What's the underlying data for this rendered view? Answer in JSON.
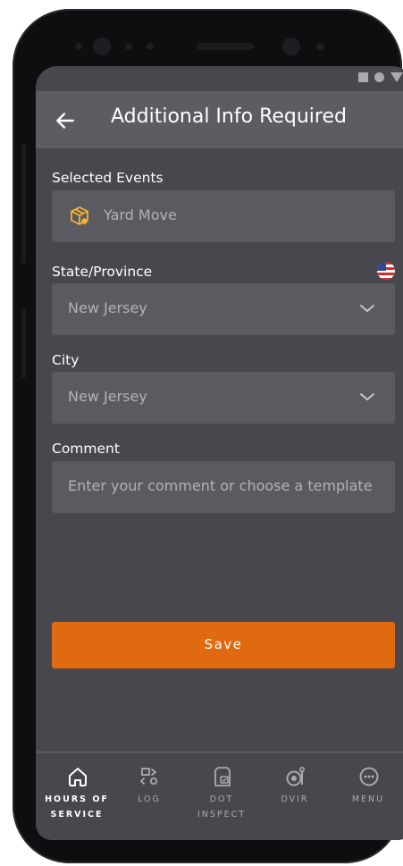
{
  "appbar": {
    "title": "Additional Info Required"
  },
  "selected_events": {
    "label": "Selected Events",
    "value": "Yard Move"
  },
  "state": {
    "label": "State/Province",
    "value": "New Jersey"
  },
  "city": {
    "label": "City",
    "value": "New Jersey"
  },
  "comment": {
    "label": "Comment",
    "placeholder": "Enter your comment or choose a template"
  },
  "save": {
    "label": "Save"
  },
  "nav": [
    {
      "line1": "HOURS OF",
      "line2": "SERVICE",
      "active": true
    },
    {
      "line1": "LOG",
      "line2": ""
    },
    {
      "line1": "DOT",
      "line2": "INSPECT"
    },
    {
      "line1": "DVIR",
      "line2": ""
    },
    {
      "line1": "MENU",
      "line2": ""
    }
  ],
  "colors": {
    "screen_bg": "#47474d",
    "appbar_bg": "#5c5c62",
    "field_bg": "#5a5a60",
    "accent": "#e06a10",
    "event_icon": "#f2b434"
  },
  "icons": {
    "back": "arrow-left-icon",
    "event": "package-box-icon",
    "flag": "us-flag-icon",
    "dropdown": "chevron-down-icon",
    "nav": [
      "home-icon",
      "log-icon",
      "clipboard-check-icon",
      "dvir-tire-icon",
      "menu-dots-icon"
    ]
  }
}
